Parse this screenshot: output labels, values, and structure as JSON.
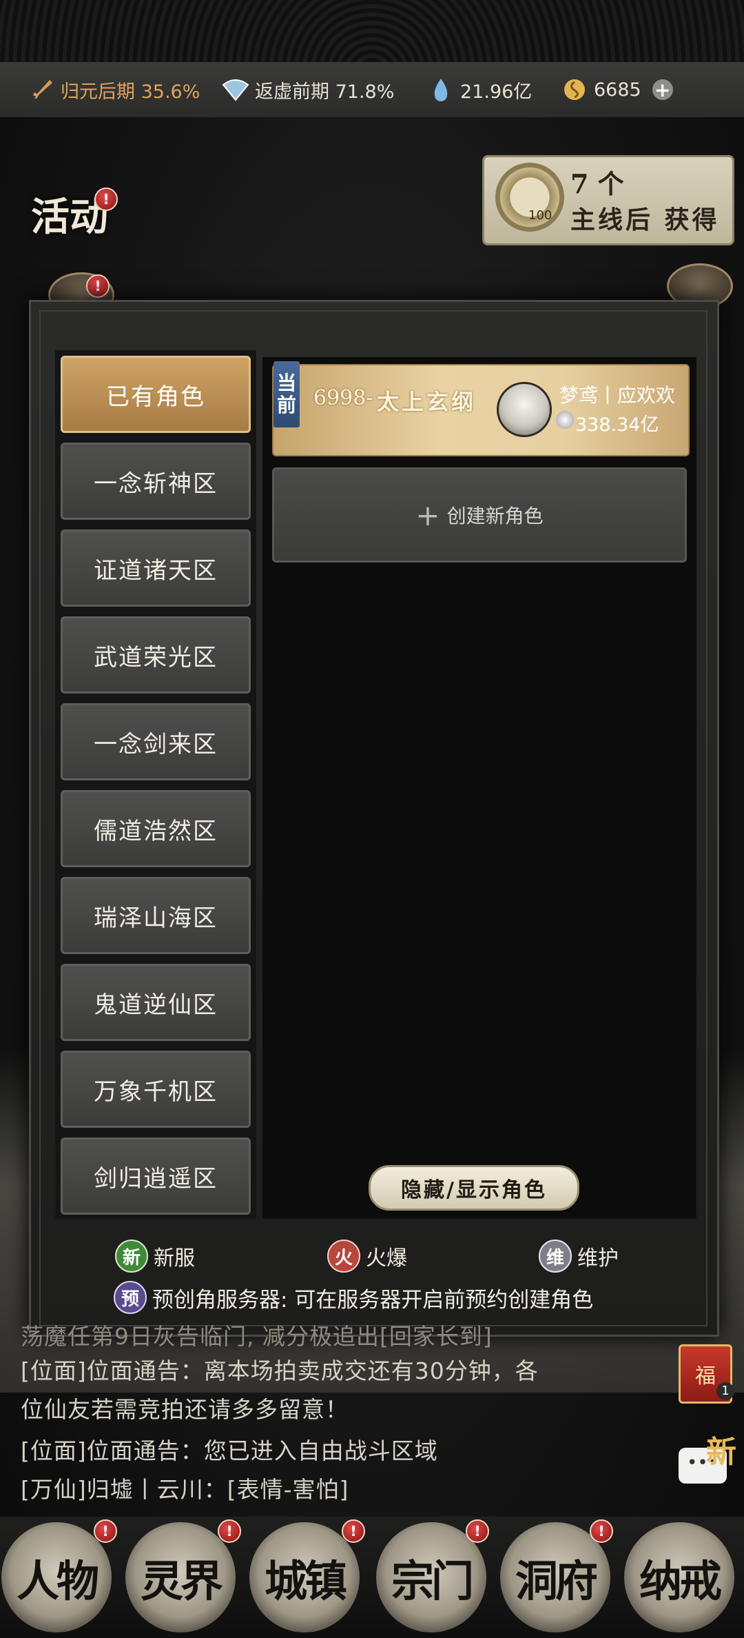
{
  "status": {
    "stat1": {
      "icon": "sword-icon",
      "value": "归元后期 35.6%"
    },
    "stat2": {
      "icon": "fan-icon",
      "value": "返虚前期 71.8%"
    },
    "stat3": {
      "icon": "spirit-drop-icon",
      "value": "21.96亿"
    },
    "stat4": {
      "icon": "coin-icon",
      "value": "6685"
    },
    "add_icon": "plus-icon"
  },
  "scene": {
    "activity_label": "活动",
    "reward_count": "7 个",
    "reward_text": "主线后 获得",
    "reward_badge": "100"
  },
  "dialog": {
    "tabs": [
      "已有角色",
      "一念斩神区",
      "证道诸天区",
      "武道荣光区",
      "一念剑来区",
      "儒道浩然区",
      "瑞泽山海区",
      "鬼道逆仙区",
      "万象千机区",
      "剑归逍遥区"
    ],
    "current_tag": [
      "当",
      "前"
    ],
    "character": {
      "server_id": "6998-",
      "server_name": "太上玄纲",
      "user": "梦鸢丨应欢欢",
      "power": "338.34亿"
    },
    "create_label": "创建新角色",
    "toggle_label": "隐藏/显示角色",
    "legend": [
      {
        "badge": "新",
        "label": "新服",
        "color": "#3f8a3a"
      },
      {
        "badge": "火",
        "label": "火爆",
        "color": "#b8463c"
      },
      {
        "badge": "维",
        "label": "维护",
        "color": "#7e7e86"
      }
    ],
    "pre_badge": "预",
    "pre_note": "预创角服务器: 可在服务器开启前预约创建角色"
  },
  "chat": {
    "line0": "荡魔任第9日灰告临门, 减分极追出[回家长到]",
    "line1": "[位面]位面通告：离本场拍卖成交还有30分钟，各",
    "line2": "位仙友若需竞拍还请多多留意！",
    "line3": "[位面]位面通告：您已进入自由战斗区域",
    "line4": "[万仙]归墟丨云川：[表情-害怕]"
  },
  "right": {
    "fu": "福",
    "fu_count": "1",
    "new_label": "新"
  },
  "nav": [
    "人物",
    "灵界",
    "城镇",
    "宗门",
    "洞府",
    "纳戒"
  ]
}
